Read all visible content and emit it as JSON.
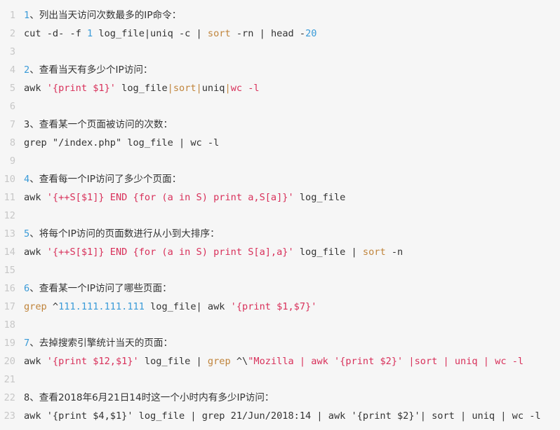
{
  "lines": [
    {
      "n": "1",
      "tokens": [
        {
          "k": "num",
          "t": "1"
        },
        {
          "k": "cmt",
          "t": "、列出当天访问次数最多的IP命令："
        }
      ]
    },
    {
      "n": "2",
      "tokens": [
        {
          "k": "plain",
          "t": "cut -d- -f "
        },
        {
          "k": "num",
          "t": "1"
        },
        {
          "k": "plain",
          "t": " log_file|uniq -c | "
        },
        {
          "k": "kw",
          "t": "sort"
        },
        {
          "k": "plain",
          "t": " -rn | head -"
        },
        {
          "k": "num",
          "t": "20"
        }
      ]
    },
    {
      "n": "3",
      "tokens": []
    },
    {
      "n": "4",
      "tokens": [
        {
          "k": "num",
          "t": "2"
        },
        {
          "k": "cmt",
          "t": "、查看当天有多少个IP访问："
        }
      ]
    },
    {
      "n": "5",
      "tokens": [
        {
          "k": "plain",
          "t": "awk "
        },
        {
          "k": "str",
          "t": "'{print $1}'"
        },
        {
          "k": "plain",
          "t": " log_file"
        },
        {
          "k": "kw",
          "t": "|sort|"
        },
        {
          "k": "plain",
          "t": "uniq"
        },
        {
          "k": "kw",
          "t": "|"
        },
        {
          "k": "str",
          "t": "wc -l"
        }
      ]
    },
    {
      "n": "6",
      "tokens": []
    },
    {
      "n": "7",
      "tokens": [
        {
          "k": "plain",
          "t": "3"
        },
        {
          "k": "cmt",
          "t": "、查看某一个页面被访问的次数："
        }
      ]
    },
    {
      "n": "8",
      "tokens": [
        {
          "k": "plain",
          "t": "grep \"/index.php\" log_file | wc -l"
        }
      ]
    },
    {
      "n": "9",
      "tokens": []
    },
    {
      "n": "10",
      "tokens": [
        {
          "k": "num",
          "t": "4"
        },
        {
          "k": "cmt",
          "t": "、查看每一个IP访问了多少个页面："
        }
      ]
    },
    {
      "n": "11",
      "tokens": [
        {
          "k": "plain",
          "t": "awk "
        },
        {
          "k": "str",
          "t": "'{++S[$1]} END {for (a in S) print a,S[a]}'"
        },
        {
          "k": "plain",
          "t": " log_file"
        }
      ]
    },
    {
      "n": "12",
      "tokens": []
    },
    {
      "n": "13",
      "tokens": [
        {
          "k": "num",
          "t": "5"
        },
        {
          "k": "cmt",
          "t": "、将每个IP访问的页面数进行从小到大排序："
        }
      ]
    },
    {
      "n": "14",
      "tokens": [
        {
          "k": "plain",
          "t": "awk "
        },
        {
          "k": "str",
          "t": "'{++S[$1]} END {for (a in S) print S[a],a}'"
        },
        {
          "k": "plain",
          "t": " log_file | "
        },
        {
          "k": "kw",
          "t": "sort"
        },
        {
          "k": "plain",
          "t": " -n"
        }
      ]
    },
    {
      "n": "15",
      "tokens": []
    },
    {
      "n": "16",
      "tokens": [
        {
          "k": "num",
          "t": "6"
        },
        {
          "k": "cmt",
          "t": "、查看某一个IP访问了哪些页面："
        }
      ]
    },
    {
      "n": "17",
      "tokens": [
        {
          "k": "kw",
          "t": "grep"
        },
        {
          "k": "plain",
          "t": " ^"
        },
        {
          "k": "num",
          "t": "111.111.111.111"
        },
        {
          "k": "plain",
          "t": " log_file| awk "
        },
        {
          "k": "str",
          "t": "'{print $1,$7}'"
        }
      ]
    },
    {
      "n": "18",
      "tokens": []
    },
    {
      "n": "19",
      "tokens": [
        {
          "k": "num",
          "t": "7"
        },
        {
          "k": "cmt",
          "t": "、去掉搜索引擎统计当天的页面："
        }
      ]
    },
    {
      "n": "20",
      "tokens": [
        {
          "k": "plain",
          "t": "awk "
        },
        {
          "k": "str",
          "t": "'{print $12,$1}'"
        },
        {
          "k": "plain",
          "t": " log_file | "
        },
        {
          "k": "kw",
          "t": "grep"
        },
        {
          "k": "plain",
          "t": " ^\\"
        },
        {
          "k": "str",
          "t": "\"Mozilla | awk '{print $2}' |sort | uniq | wc -l"
        }
      ]
    },
    {
      "n": "21",
      "tokens": []
    },
    {
      "n": "22",
      "tokens": [
        {
          "k": "plain",
          "t": "8"
        },
        {
          "k": "cmt",
          "t": "、查看2018年6月21日14时这一个小时内有多少IP访问："
        }
      ]
    },
    {
      "n": "23",
      "tokens": [
        {
          "k": "plain",
          "t": "awk '{print $4,$1}' log_file | grep 21/Jun/2018:14 | awk '{print $2}'| sort | uniq | wc -l"
        }
      ]
    }
  ],
  "colors": {
    "background": "#f6f6f6",
    "gutter": "#c7c7c7",
    "plain": "#333333",
    "number": "#3a9bd8",
    "string": "#d8305a",
    "keyword": "#c0843b"
  }
}
